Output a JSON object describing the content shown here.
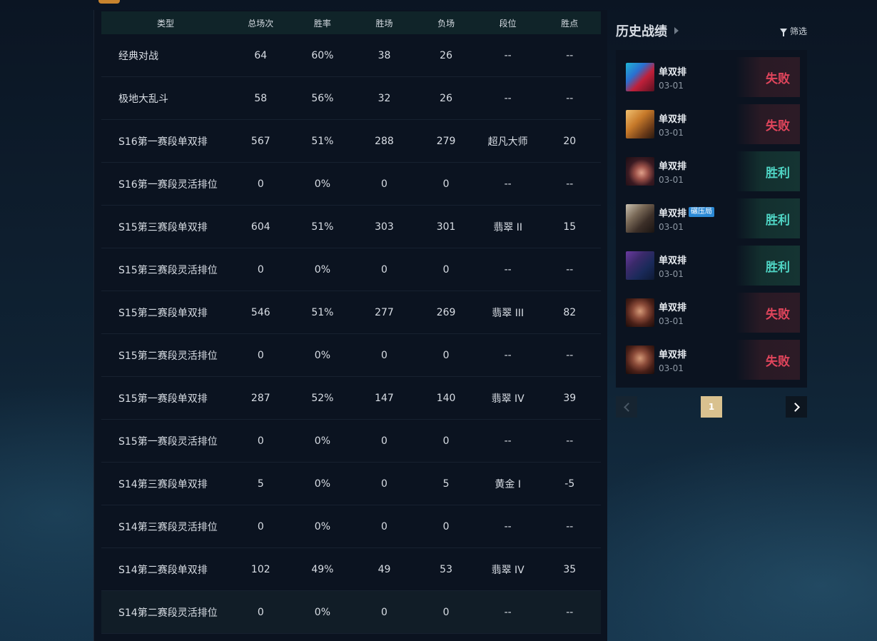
{
  "table": {
    "headers": [
      "类型",
      "总场次",
      "胜率",
      "胜场",
      "负场",
      "段位",
      "胜点"
    ],
    "rows": [
      [
        "经典对战",
        "64",
        "60%",
        "38",
        "26",
        "--",
        "--"
      ],
      [
        "极地大乱斗",
        "58",
        "56%",
        "32",
        "26",
        "--",
        "--"
      ],
      [
        "S16第一赛段单双排",
        "567",
        "51%",
        "288",
        "279",
        "超凡大师",
        "20"
      ],
      [
        "S16第一赛段灵活排位",
        "0",
        "0%",
        "0",
        "0",
        "--",
        "--"
      ],
      [
        "S15第三赛段单双排",
        "604",
        "51%",
        "303",
        "301",
        "翡翠 II",
        "15"
      ],
      [
        "S15第三赛段灵活排位",
        "0",
        "0%",
        "0",
        "0",
        "--",
        "--"
      ],
      [
        "S15第二赛段单双排",
        "546",
        "51%",
        "277",
        "269",
        "翡翠 III",
        "82"
      ],
      [
        "S15第二赛段灵活排位",
        "0",
        "0%",
        "0",
        "0",
        "--",
        "--"
      ],
      [
        "S15第一赛段单双排",
        "287",
        "52%",
        "147",
        "140",
        "翡翠 IV",
        "39"
      ],
      [
        "S15第一赛段灵活排位",
        "0",
        "0%",
        "0",
        "0",
        "--",
        "--"
      ],
      [
        "S14第三赛段单双排",
        "5",
        "0%",
        "0",
        "5",
        "黄金 I",
        "-5"
      ],
      [
        "S14第三赛段灵活排位",
        "0",
        "0%",
        "0",
        "0",
        "--",
        "--"
      ],
      [
        "S14第二赛段单双排",
        "102",
        "49%",
        "49",
        "53",
        "翡翠 IV",
        "35"
      ],
      [
        "S14第二赛段灵活排位",
        "0",
        "0%",
        "0",
        "0",
        "--",
        "--"
      ]
    ]
  },
  "history": {
    "title": "历史战绩",
    "filter_label": "筛选",
    "matches": [
      {
        "mode": "单双排",
        "date": "03-01",
        "result": "失败",
        "outcome": "loss",
        "champion_icon": "champion-portrait-red-blue",
        "tag": ""
      },
      {
        "mode": "单双排",
        "date": "03-01",
        "result": "失败",
        "outcome": "loss",
        "champion_icon": "champion-portrait-orange-beast",
        "tag": ""
      },
      {
        "mode": "单双排",
        "date": "03-01",
        "result": "胜利",
        "outcome": "win",
        "champion_icon": "champion-portrait-dark-hair-woman",
        "tag": ""
      },
      {
        "mode": "单双排",
        "date": "03-01",
        "result": "胜利",
        "outcome": "win",
        "champion_icon": "champion-portrait-armored-knight",
        "tag": "碾压局"
      },
      {
        "mode": "单双排",
        "date": "03-01",
        "result": "胜利",
        "outcome": "win",
        "champion_icon": "champion-portrait-purple-swordsman",
        "tag": ""
      },
      {
        "mode": "单双排",
        "date": "03-01",
        "result": "失败",
        "outcome": "loss",
        "champion_icon": "champion-portrait-bearded-warrior",
        "tag": ""
      },
      {
        "mode": "单双排",
        "date": "03-01",
        "result": "失败",
        "outcome": "loss",
        "champion_icon": "champion-portrait-bearded-warrior",
        "tag": ""
      }
    ],
    "pagination": {
      "current_page": "1"
    }
  },
  "colors": {
    "win": "#4fd4c4",
    "loss": "#e0455c",
    "page_active": "#d9c18f",
    "tag": "#2c8ad6"
  }
}
